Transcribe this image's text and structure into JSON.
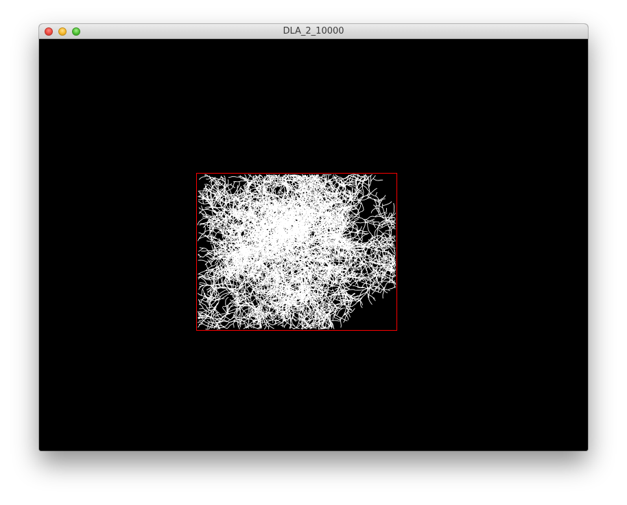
{
  "window": {
    "title": "DLA_2_10000"
  },
  "canvas": {
    "background_color": "#000000",
    "cluster_color": "#ffffff",
    "bounding_box_color": "#ff0000"
  }
}
